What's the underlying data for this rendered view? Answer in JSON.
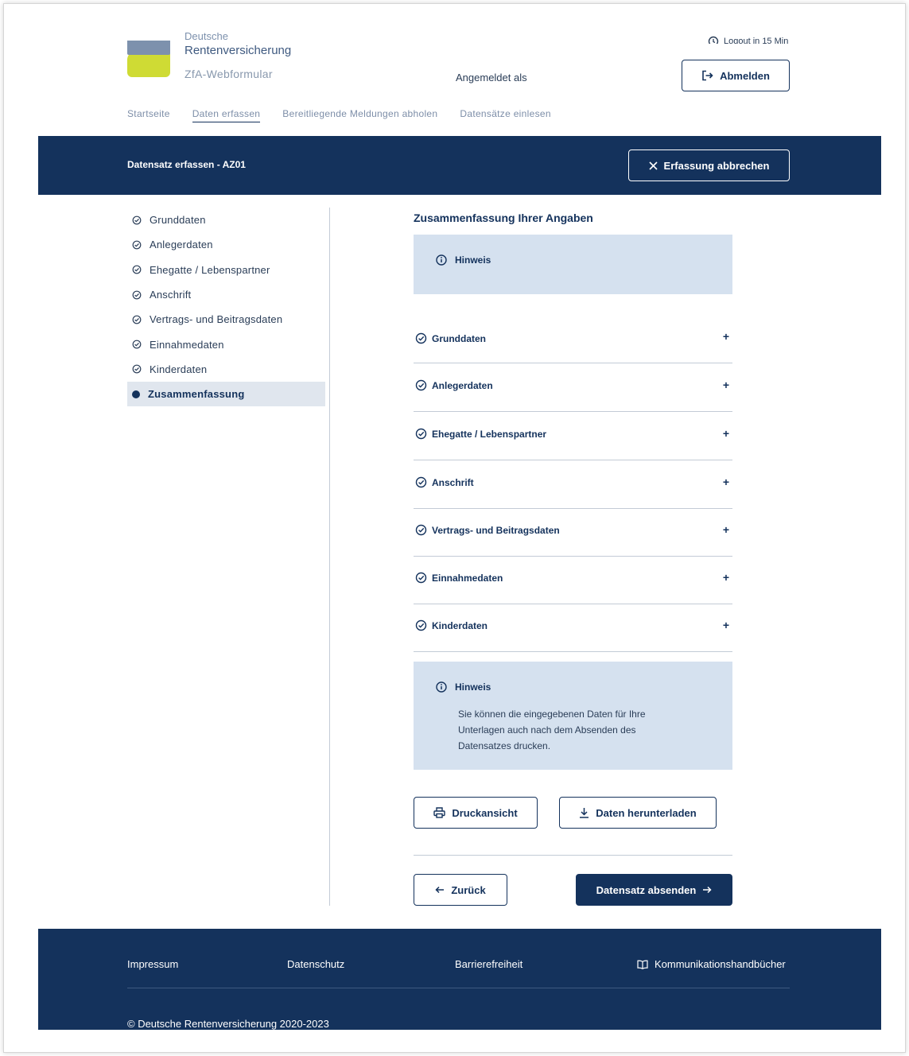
{
  "header": {
    "brand_top": "Deutsche",
    "brand_name": "Rentenversicherung",
    "brand_sub": "ZfA-Webformular",
    "logged_in_as": "Angemeldet als",
    "logout_timer": "Logout in 15 Min",
    "logout_button": "Abmelden"
  },
  "nav": {
    "items": [
      "Startseite",
      "Daten erfassen",
      "Bereitliegende Meldungen abholen",
      "Datensätze einlesen"
    ],
    "active": "Daten erfassen"
  },
  "bar": {
    "title": "Datensatz erfassen - AZ01",
    "cancel_button": "Erfassung abbrechen"
  },
  "sidebar": {
    "items": [
      {
        "label": "Grunddaten",
        "state": "done"
      },
      {
        "label": "Anlegerdaten",
        "state": "done"
      },
      {
        "label": "Ehegatte / Lebenspartner",
        "state": "done"
      },
      {
        "label": "Anschrift",
        "state": "done"
      },
      {
        "label": "Vertrags- und Beitragsdaten",
        "state": "done"
      },
      {
        "label": "Einnahmedaten",
        "state": "done"
      },
      {
        "label": "Kinderdaten",
        "state": "done"
      },
      {
        "label": "Zusammenfassung",
        "state": "current"
      }
    ]
  },
  "main": {
    "title": "Zusammenfassung Ihrer Angaben",
    "hint1_title": "Hinweis",
    "sections": [
      {
        "label": "Grunddaten",
        "expand": "+"
      },
      {
        "label": "Anlegerdaten",
        "expand": "+"
      },
      {
        "label": "Ehegatte / Lebenspartner",
        "expand": "+"
      },
      {
        "label": "Anschrift",
        "expand": "+"
      },
      {
        "label": "Vertrags- und Beitragsdaten",
        "expand": "+"
      },
      {
        "label": "Einnahmedaten",
        "expand": "+"
      },
      {
        "label": "Kinderdaten",
        "expand": "+"
      }
    ],
    "hint2_title": "Hinweis",
    "hint2_text": "Sie können die eingegebenen Daten für Ihre Unterlagen auch nach dem Absenden des Datensatzes drucken.",
    "print_button": "Druckansicht",
    "download_button": "Daten herunterladen",
    "back_button": "Zurück",
    "submit_button": "Datensatz absenden"
  },
  "footer": {
    "links": [
      "Impressum",
      "Datenschutz",
      "Barrierefreiheit",
      "Kommunikationshandbücher"
    ],
    "copyright": "© Deutsche Rentenversicherung 2020-2023"
  },
  "colors": {
    "primary": "#14325c",
    "hint_bg": "#d5e1ef",
    "logo_blue": "#7d91ad",
    "logo_green": "#cfdb34",
    "sidebar_active_bg": "#e0e6ee"
  }
}
